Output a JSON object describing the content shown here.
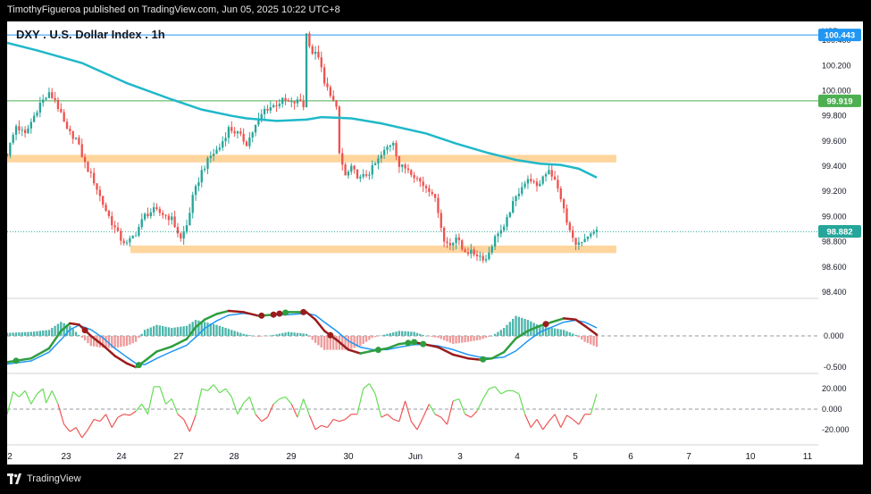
{
  "header": {
    "publisher_line": "TimothyFigueroa published on TradingView.com, Jun 05, 2025 10:22 UTC+8"
  },
  "footer": {
    "brand": "TradingView"
  },
  "chart_title": "DXY . U.S. Dollar Index . 1h",
  "currency": "USD",
  "colors": {
    "bull": "#26a69a",
    "bear": "#ef5350",
    "ma": "#1fb8c9",
    "zone": "#ffd59e",
    "blue_line": "#2196f3",
    "green_line": "#4caf50",
    "osc_fast": "#2e9e3e",
    "osc_slow": "#9b1c1c",
    "rsi_up": "#66dd55",
    "rsi_down": "#ee5555"
  },
  "price_labels": {
    "top_line": "100.443",
    "mid_line": "99.919",
    "current": "98.882"
  },
  "chart_data": [
    {
      "type": "candlestick",
      "title": "DXY . U.S. Dollar Index . 1h",
      "ylim": [
        98.35,
        100.55
      ],
      "y_ticks": [
        "100.400",
        "100.200",
        "100.000",
        "99.800",
        "99.600",
        "99.400",
        "99.200",
        "99.000",
        "98.800",
        "98.600",
        "98.400"
      ],
      "x_tick_labels": [
        "2",
        "23",
        "24",
        "27",
        "28",
        "29",
        "30",
        "Jun",
        "3",
        "4",
        "5",
        "6",
        "7",
        "10",
        "11"
      ],
      "horizontal_lines": [
        100.443,
        99.919
      ],
      "zones": [
        [
          99.43,
          99.49
        ],
        [
          98.71,
          98.77
        ]
      ],
      "moving_average": [
        [
          0,
          100.38
        ],
        [
          10,
          100.32
        ],
        [
          25,
          100.22
        ],
        [
          40,
          100.06
        ],
        [
          55,
          99.93
        ],
        [
          65,
          99.85
        ],
        [
          75,
          99.8
        ],
        [
          80,
          99.78
        ],
        [
          90,
          99.76
        ],
        [
          100,
          99.77
        ],
        [
          105,
          99.79
        ],
        [
          115,
          99.78
        ],
        [
          125,
          99.74
        ],
        [
          140,
          99.66
        ],
        [
          150,
          99.58
        ],
        [
          160,
          99.51
        ],
        [
          170,
          99.45
        ],
        [
          178,
          99.42
        ],
        [
          185,
          99.41
        ],
        [
          191,
          99.38
        ],
        [
          197,
          99.31
        ]
      ],
      "close_path": [
        [
          0,
          99.5
        ],
        [
          3,
          99.72
        ],
        [
          6,
          99.65
        ],
        [
          8,
          99.75
        ],
        [
          11,
          99.9
        ],
        [
          14,
          99.97
        ],
        [
          16,
          99.93
        ],
        [
          20,
          99.68
        ],
        [
          23,
          99.62
        ],
        [
          26,
          99.42
        ],
        [
          29,
          99.28
        ],
        [
          32,
          99.1
        ],
        [
          35,
          98.95
        ],
        [
          38,
          98.82
        ],
        [
          40,
          98.78
        ],
        [
          43,
          98.87
        ],
        [
          46,
          99.01
        ],
        [
          49,
          99.05
        ],
        [
          52,
          99.02
        ],
        [
          55,
          98.98
        ],
        [
          58,
          98.82
        ],
        [
          60,
          98.93
        ],
        [
          62,
          99.15
        ],
        [
          65,
          99.36
        ],
        [
          68,
          99.48
        ],
        [
          71,
          99.55
        ],
        [
          74,
          99.7
        ],
        [
          77,
          99.66
        ],
        [
          80,
          99.58
        ],
        [
          83,
          99.72
        ],
        [
          86,
          99.85
        ],
        [
          89,
          99.88
        ],
        [
          92,
          99.92
        ],
        [
          95,
          99.9
        ],
        [
          98,
          99.92
        ],
        [
          99,
          99.88
        ],
        [
          100,
          100.45
        ],
        [
          102,
          100.3
        ],
        [
          104,
          100.28
        ],
        [
          106,
          100.05
        ],
        [
          108,
          99.98
        ],
        [
          110,
          99.85
        ],
        [
          111,
          99.5
        ],
        [
          113,
          99.32
        ],
        [
          115,
          99.38
        ],
        [
          118,
          99.3
        ],
        [
          121,
          99.35
        ],
        [
          124,
          99.45
        ],
        [
          127,
          99.55
        ],
        [
          129,
          99.6
        ],
        [
          131,
          99.4
        ],
        [
          134,
          99.38
        ],
        [
          136,
          99.33
        ],
        [
          139,
          99.25
        ],
        [
          142,
          99.2
        ],
        [
          144,
          99.05
        ],
        [
          146,
          98.8
        ],
        [
          148,
          98.78
        ],
        [
          150,
          98.84
        ],
        [
          152,
          98.74
        ],
        [
          154,
          98.72
        ],
        [
          157,
          98.7
        ],
        [
          160,
          98.66
        ],
        [
          162,
          98.78
        ],
        [
          164,
          98.88
        ],
        [
          166,
          98.9
        ],
        [
          168,
          99.05
        ],
        [
          170,
          99.15
        ],
        [
          172,
          99.25
        ],
        [
          175,
          99.3
        ],
        [
          177,
          99.22
        ],
        [
          179,
          99.32
        ],
        [
          181,
          99.38
        ],
        [
          183,
          99.28
        ],
        [
          185,
          99.15
        ],
        [
          187,
          98.95
        ],
        [
          189,
          98.82
        ],
        [
          191,
          98.78
        ],
        [
          193,
          98.8
        ],
        [
          195,
          98.85
        ],
        [
          197,
          98.88
        ]
      ],
      "n_candles": 198
    },
    {
      "type": "line",
      "ylim": [
        -0.6,
        0.6
      ],
      "y_ticks": [
        "0.000",
        "-0.500"
      ],
      "series": [
        {
          "values": [
            [
              0,
              -0.42
            ],
            [
              8,
              -0.36
            ],
            [
              14,
              -0.2
            ],
            [
              18,
              0.08
            ],
            [
              21,
              0.2
            ],
            [
              24,
              0.18
            ],
            [
              28,
              0.0
            ],
            [
              32,
              -0.15
            ],
            [
              36,
              -0.32
            ],
            [
              40,
              -0.44
            ],
            [
              43,
              -0.5
            ],
            [
              46,
              -0.4
            ],
            [
              50,
              -0.25
            ],
            [
              55,
              -0.17
            ],
            [
              60,
              -0.05
            ],
            [
              63,
              0.14
            ],
            [
              66,
              0.26
            ],
            [
              70,
              0.35
            ],
            [
              74,
              0.4
            ],
            [
              79,
              0.38
            ],
            [
              84,
              0.32
            ],
            [
              89,
              0.34
            ],
            [
              94,
              0.38
            ],
            [
              100,
              0.38
            ],
            [
              103,
              0.26
            ],
            [
              106,
              0.08
            ],
            [
              110,
              -0.06
            ],
            [
              114,
              -0.22
            ],
            [
              118,
              -0.28
            ],
            [
              122,
              -0.24
            ],
            [
              127,
              -0.2
            ],
            [
              131,
              -0.13
            ],
            [
              136,
              -0.1
            ],
            [
              140,
              -0.14
            ],
            [
              144,
              -0.18
            ],
            [
              149,
              -0.3
            ],
            [
              154,
              -0.36
            ],
            [
              158,
              -0.38
            ],
            [
              162,
              -0.36
            ],
            [
              166,
              -0.26
            ],
            [
              170,
              -0.04
            ],
            [
              174,
              0.08
            ],
            [
              178,
              0.16
            ],
            [
              182,
              0.22
            ],
            [
              186,
              0.28
            ],
            [
              190,
              0.26
            ],
            [
              193,
              0.16
            ],
            [
              197,
              0.02
            ]
          ]
        },
        {
          "values": [
            [
              0,
              -0.45
            ],
            [
              8,
              -0.4
            ],
            [
              14,
              -0.26
            ],
            [
              18,
              -0.06
            ],
            [
              21,
              0.1
            ],
            [
              24,
              0.17
            ],
            [
              28,
              0.1
            ],
            [
              32,
              -0.03
            ],
            [
              36,
              -0.2
            ],
            [
              40,
              -0.34
            ],
            [
              43,
              -0.44
            ],
            [
              46,
              -0.46
            ],
            [
              50,
              -0.36
            ],
            [
              55,
              -0.25
            ],
            [
              60,
              -0.15
            ],
            [
              63,
              -0.02
            ],
            [
              66,
              0.12
            ],
            [
              70,
              0.24
            ],
            [
              74,
              0.33
            ],
            [
              79,
              0.36
            ],
            [
              84,
              0.33
            ],
            [
              89,
              0.33
            ],
            [
              94,
              0.34
            ],
            [
              100,
              0.36
            ],
            [
              103,
              0.33
            ],
            [
              106,
              0.22
            ],
            [
              110,
              0.08
            ],
            [
              114,
              -0.08
            ],
            [
              118,
              -0.18
            ],
            [
              122,
              -0.22
            ],
            [
              127,
              -0.22
            ],
            [
              131,
              -0.18
            ],
            [
              136,
              -0.14
            ],
            [
              140,
              -0.14
            ],
            [
              144,
              -0.16
            ],
            [
              149,
              -0.22
            ],
            [
              154,
              -0.3
            ],
            [
              158,
              -0.34
            ],
            [
              162,
              -0.36
            ],
            [
              166,
              -0.34
            ],
            [
              170,
              -0.24
            ],
            [
              174,
              -0.08
            ],
            [
              178,
              0.06
            ],
            [
              182,
              0.14
            ],
            [
              186,
              0.22
            ],
            [
              190,
              0.25
            ],
            [
              193,
              0.22
            ],
            [
              197,
              0.13
            ]
          ]
        }
      ],
      "cross_up": [
        3,
        44,
        93,
        124,
        134,
        136,
        139,
        159
      ],
      "cross_down": [
        26,
        85,
        89,
        91,
        99,
        108,
        180
      ]
    },
    {
      "type": "line",
      "ylim": [
        -35,
        35
      ],
      "y_ticks": [
        "20.000",
        "0.000",
        "-20.000"
      ],
      "values": [
        [
          0,
          -5
        ],
        [
          2,
          17
        ],
        [
          4,
          12
        ],
        [
          6,
          18
        ],
        [
          8,
          5
        ],
        [
          10,
          15
        ],
        [
          12,
          20
        ],
        [
          13,
          6
        ],
        [
          15,
          18
        ],
        [
          17,
          5
        ],
        [
          19,
          -15
        ],
        [
          21,
          -22
        ],
        [
          23,
          -18
        ],
        [
          25,
          -28
        ],
        [
          27,
          -20
        ],
        [
          29,
          -10
        ],
        [
          31,
          -12
        ],
        [
          33,
          -5
        ],
        [
          35,
          -18
        ],
        [
          37,
          -8
        ],
        [
          39,
          -5
        ],
        [
          41,
          -6
        ],
        [
          43,
          -2
        ],
        [
          45,
          5
        ],
        [
          47,
          -5
        ],
        [
          49,
          22
        ],
        [
          51,
          22
        ],
        [
          53,
          5
        ],
        [
          55,
          10
        ],
        [
          57,
          -5
        ],
        [
          59,
          -10
        ],
        [
          61,
          -22
        ],
        [
          63,
          -6
        ],
        [
          65,
          20
        ],
        [
          67,
          18
        ],
        [
          69,
          24
        ],
        [
          71,
          16
        ],
        [
          73,
          20
        ],
        [
          75,
          12
        ],
        [
          77,
          -5
        ],
        [
          79,
          6
        ],
        [
          81,
          12
        ],
        [
          83,
          -5
        ],
        [
          85,
          -12
        ],
        [
          87,
          -8
        ],
        [
          89,
          5
        ],
        [
          91,
          10
        ],
        [
          93,
          12
        ],
        [
          95,
          5
        ],
        [
          97,
          -8
        ],
        [
          99,
          10
        ],
        [
          101,
          -6
        ],
        [
          103,
          -20
        ],
        [
          105,
          -16
        ],
        [
          107,
          -18
        ],
        [
          109,
          -10
        ],
        [
          111,
          -12
        ],
        [
          113,
          -10
        ],
        [
          115,
          -5
        ],
        [
          117,
          -5
        ],
        [
          119,
          20
        ],
        [
          121,
          25
        ],
        [
          123,
          15
        ],
        [
          125,
          -8
        ],
        [
          127,
          -5
        ],
        [
          129,
          -10
        ],
        [
          131,
          -12
        ],
        [
          133,
          8
        ],
        [
          135,
          -12
        ],
        [
          137,
          -20
        ],
        [
          139,
          -8
        ],
        [
          141,
          5
        ],
        [
          143,
          -5
        ],
        [
          145,
          -8
        ],
        [
          147,
          -15
        ],
        [
          149,
          8
        ],
        [
          151,
          10
        ],
        [
          153,
          -5
        ],
        [
          155,
          -8
        ],
        [
          157,
          -2
        ],
        [
          159,
          10
        ],
        [
          161,
          20
        ],
        [
          163,
          22
        ],
        [
          165,
          15
        ],
        [
          167,
          18
        ],
        [
          169,
          18
        ],
        [
          171,
          15
        ],
        [
          173,
          -5
        ],
        [
          175,
          -18
        ],
        [
          177,
          -10
        ],
        [
          179,
          -20
        ],
        [
          181,
          -12
        ],
        [
          183,
          -5
        ],
        [
          185,
          -18
        ],
        [
          187,
          -6
        ],
        [
          189,
          -10
        ],
        [
          191,
          -15
        ],
        [
          193,
          -5
        ],
        [
          195,
          -5
        ],
        [
          197,
          15
        ]
      ]
    }
  ]
}
